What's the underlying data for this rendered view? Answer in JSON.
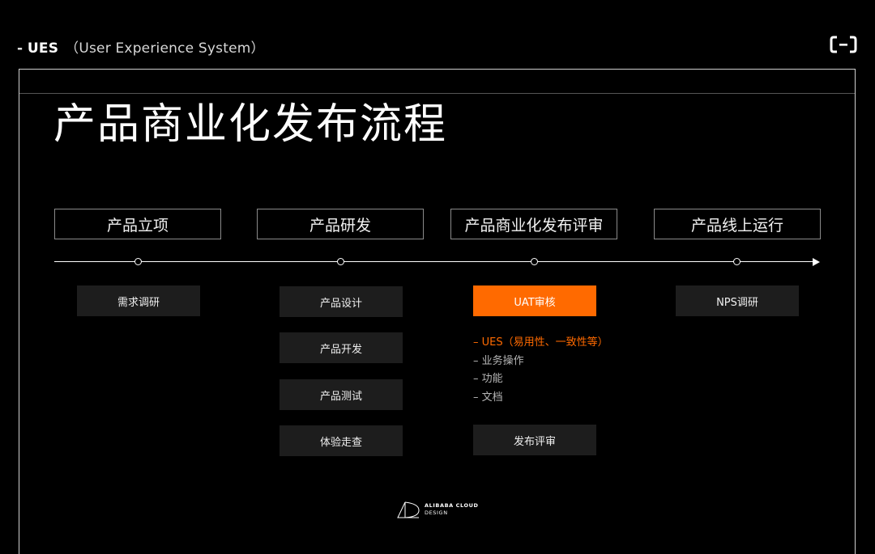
{
  "header": {
    "dash": "-",
    "brand": "UES",
    "full_name": "（User Experience System）",
    "logo_icon": "alibaba-cloud-bracket-icon"
  },
  "title": "产品商业化发布流程",
  "stages": [
    {
      "label": "产品立项"
    },
    {
      "label": "产品研发"
    },
    {
      "label": "产品商业化发布评审"
    },
    {
      "label": "产品线上运行"
    }
  ],
  "tasks": {
    "stage1": [
      "需求调研"
    ],
    "stage2": [
      "产品设计",
      "产品开发",
      "产品测试",
      "体验走查"
    ],
    "stage3_primary": "UAT审核",
    "stage3_secondary": "发布评审",
    "stage4": [
      "NPS调研"
    ]
  },
  "uat_notes": [
    "– UES（易用性、一致性等）",
    "– 业务操作",
    "– 功能",
    "– 文档"
  ],
  "footer": {
    "line1": "ALIBABA CLOUD",
    "line2": "DESIGN"
  },
  "colors": {
    "accent": "#ff6a00",
    "background": "#000000",
    "task_fill": "#1d1d1d"
  }
}
